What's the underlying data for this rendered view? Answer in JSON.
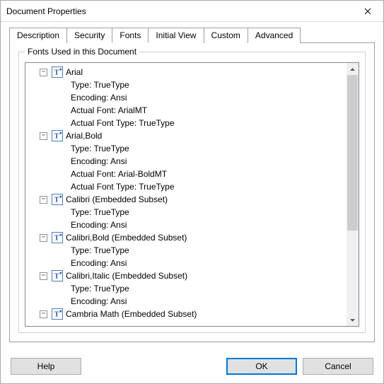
{
  "window": {
    "title": "Document Properties"
  },
  "tabs": {
    "t0": "Description",
    "t1": "Security",
    "t2": "Fonts",
    "t3": "Initial View",
    "t4": "Custom",
    "t5": "Advanced",
    "active": "Fonts"
  },
  "groupbox": {
    "label": "Fonts Used in this Document"
  },
  "fonts": [
    {
      "name": "Arial",
      "details": [
        "Type: TrueType",
        "Encoding: Ansi",
        "Actual Font: ArialMT",
        "Actual Font Type: TrueType"
      ]
    },
    {
      "name": "Arial,Bold",
      "details": [
        "Type: TrueType",
        "Encoding: Ansi",
        "Actual Font: Arial-BoldMT",
        "Actual Font Type: TrueType"
      ]
    },
    {
      "name": "Calibri (Embedded Subset)",
      "details": [
        "Type: TrueType",
        "Encoding: Ansi"
      ]
    },
    {
      "name": "Calibri,Bold (Embedded Subset)",
      "details": [
        "Type: TrueType",
        "Encoding: Ansi"
      ]
    },
    {
      "name": "Calibri,Italic (Embedded Subset)",
      "details": [
        "Type: TrueType",
        "Encoding: Ansi"
      ]
    },
    {
      "name": "Cambria Math (Embedded Subset)",
      "details": []
    }
  ],
  "buttons": {
    "help": "Help",
    "ok": "OK",
    "cancel": "Cancel"
  },
  "toggle_glyph": "⊟"
}
